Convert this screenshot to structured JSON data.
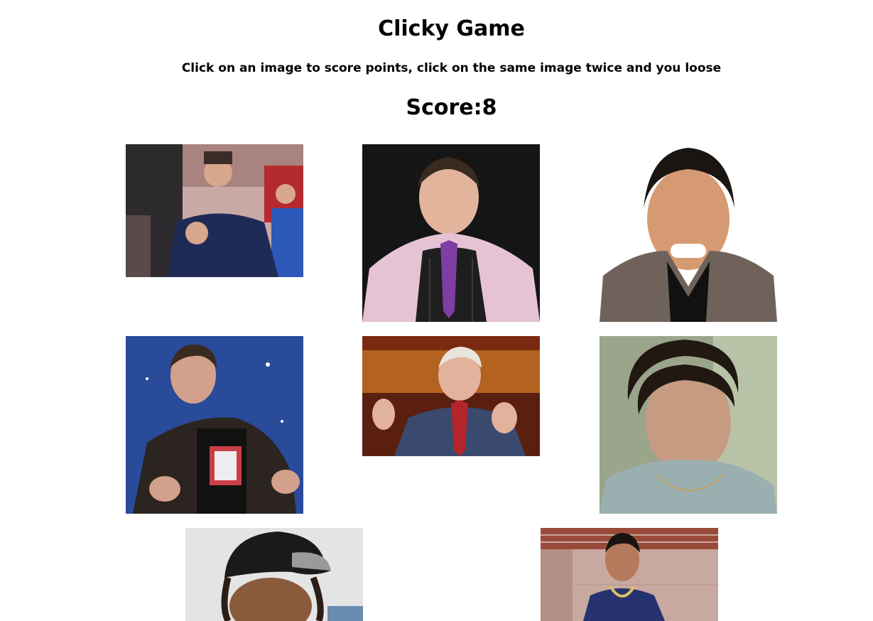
{
  "game": {
    "title": "Clicky Game",
    "instructions": "Click on an image to score points, click on the same image twice and you loose",
    "score_label": "Score:",
    "score": 8
  },
  "cards": [
    {
      "icon": "man-blue-tshirt-fist-photo"
    },
    {
      "icon": "man-pinstripe-vest-purple-tie-photo"
    },
    {
      "icon": "man-smiling-brown-blazer-photo"
    },
    {
      "icon": "man-leather-jacket-thumbs-up-photo"
    },
    {
      "icon": "older-man-gesturing-red-tie-photo"
    },
    {
      "icon": "woman-vintage-portrait-photo"
    },
    {
      "icon": "person-black-cap-braids-photo"
    },
    {
      "icon": "man-navy-shirt-chain-photo"
    }
  ],
  "colors": {
    "background": "#ffffff",
    "text": "#000000"
  }
}
